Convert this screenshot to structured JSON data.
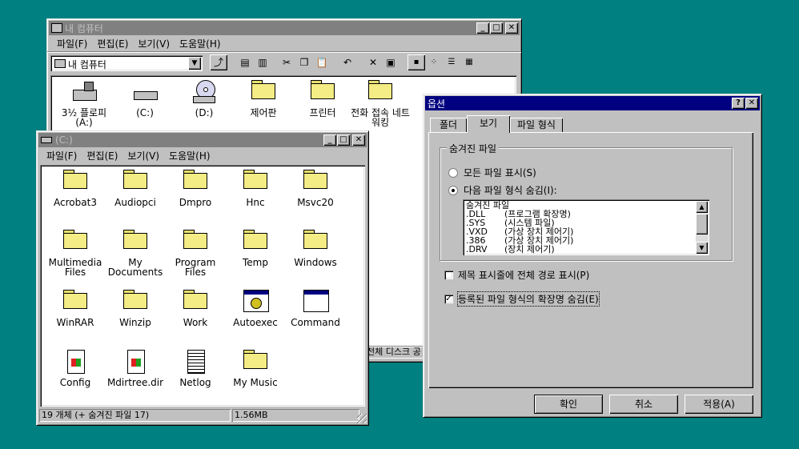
{
  "mycomputer": {
    "title": "내 컴퓨터",
    "menu": [
      "파일(F)",
      "편집(E)",
      "보기(V)",
      "도움말(H)"
    ],
    "address": "내 컴퓨터",
    "items": [
      {
        "label": "3½ 플로피 (A:)"
      },
      {
        "label": "(C:)"
      },
      {
        "label": "(D:)"
      },
      {
        "label": "제어판"
      },
      {
        "label": "프린터"
      },
      {
        "label": "전화 접속 네트워킹"
      }
    ],
    "status_partial": "전체 디스크 공"
  },
  "cdrive": {
    "title": "(C:)",
    "menu": [
      "파일(F)",
      "편집(E)",
      "보기(V)",
      "도움말(H)"
    ],
    "items": [
      {
        "label": "Acrobat3",
        "icon": "folder-icon"
      },
      {
        "label": "Audiopci",
        "icon": "folder-icon"
      },
      {
        "label": "Dmpro",
        "icon": "folder-icon"
      },
      {
        "label": "Hnc",
        "icon": "folder-icon"
      },
      {
        "label": "Msvc20",
        "icon": "folder-icon"
      },
      {
        "label": "Multimedia Files",
        "icon": "folder-icon"
      },
      {
        "label": "My Documents",
        "icon": "folder-icon"
      },
      {
        "label": "Program Files",
        "icon": "folder-icon"
      },
      {
        "label": "Temp",
        "icon": "folder-icon"
      },
      {
        "label": "Windows",
        "icon": "folder-icon"
      },
      {
        "label": "WinRAR",
        "icon": "folder-icon"
      },
      {
        "label": "Winzip",
        "icon": "folder-icon"
      },
      {
        "label": "Work",
        "icon": "folder-icon"
      },
      {
        "label": "Autoexec",
        "icon": "batch-file-icon"
      },
      {
        "label": "Command",
        "icon": "program-icon"
      },
      {
        "label": "Config",
        "icon": "system-file-icon"
      },
      {
        "label": "Mdirtree.dir",
        "icon": "system-file-icon"
      },
      {
        "label": "Netlog",
        "icon": "text-file-icon"
      },
      {
        "label": "My Music",
        "icon": "folder-icon"
      }
    ],
    "status_count": "19 개체 (+ 숨겨진 파일 17)",
    "status_size": "1.56MB"
  },
  "options": {
    "title": "옵션",
    "tabs": [
      "폴더",
      "보기",
      "파일 형식"
    ],
    "group_label": "숨겨진 파일",
    "radio_show_all": "모든 파일 표시(S)",
    "radio_hide": "다음 파일 형식 숨김(I):",
    "hidden_list": [
      {
        "ext": "숨겨진 파일",
        "desc": ""
      },
      {
        "ext": ".DLL",
        "desc": "(프로그램 확장명)"
      },
      {
        "ext": ".SYS",
        "desc": "(시스템 파일)"
      },
      {
        "ext": ".VXD",
        "desc": "(가상 장치 제어기)"
      },
      {
        "ext": ".386",
        "desc": "(가상 장치 제어기)"
      },
      {
        "ext": ".DRV",
        "desc": "(장치 제어기)"
      }
    ],
    "check_fullpath": "제목 표시줄에 전체 경로 표시(P)",
    "check_hide_ext": "등록된 파일 형식의 확장명 숨김(E)",
    "ok": "확인",
    "cancel": "취소",
    "apply": "적용(A)"
  }
}
